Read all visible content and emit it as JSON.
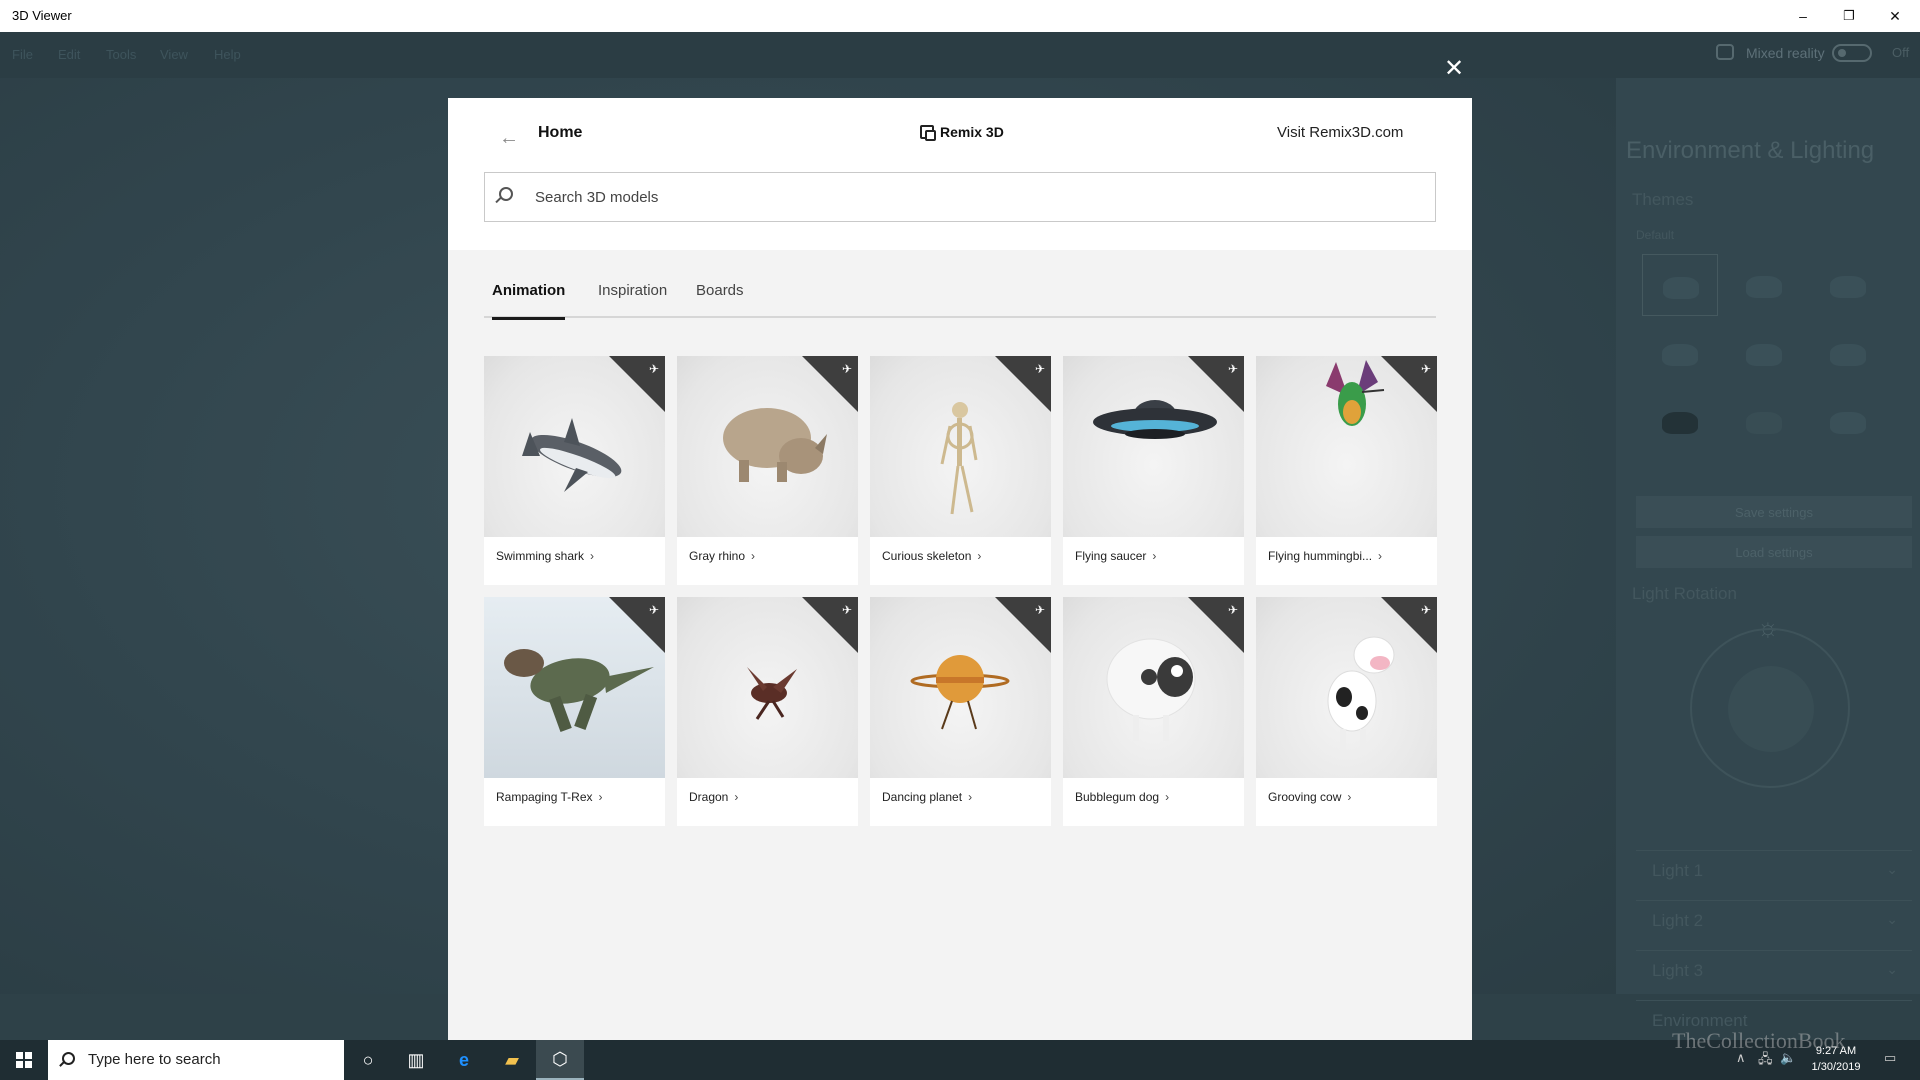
{
  "window": {
    "title": "3D Viewer",
    "minimize": "–",
    "maximize": "❐",
    "close": "✕"
  },
  "background_app": {
    "menu": [
      "File",
      "Edit",
      "Tools",
      "View",
      "Help"
    ],
    "mixed_reality": "Mixed reality",
    "toggle_state": "Off",
    "panel_title": "Environment & Lighting",
    "themes": "Themes",
    "default": "Default",
    "save_settings": "Save settings",
    "load_settings": "Load settings",
    "light_rotation": "Light Rotation",
    "lights": [
      "Light 1",
      "Light 2",
      "Light 3",
      "Environment"
    ]
  },
  "dialog": {
    "close_glyph": "✕",
    "back_glyph": "←",
    "home_title": "Home",
    "brand": "Remix 3D",
    "visit_link": "Visit Remix3D.com",
    "search_placeholder": "Search 3D models",
    "tabs": [
      "Animation",
      "Inspiration",
      "Boards"
    ],
    "active_tab": "Animation",
    "cards": [
      {
        "label": "Swimming shark",
        "thumb": "shark"
      },
      {
        "label": "Gray rhino",
        "thumb": "rhino"
      },
      {
        "label": "Curious skeleton",
        "thumb": "skeleton"
      },
      {
        "label": "Flying saucer",
        "thumb": "saucer"
      },
      {
        "label": "Flying hummingbi...",
        "thumb": "hummingbird"
      },
      {
        "label": "Rampaging T-Rex",
        "thumb": "trex"
      },
      {
        "label": "Dragon",
        "thumb": "dragon"
      },
      {
        "label": "Dancing planet",
        "thumb": "planet"
      },
      {
        "label": "Bubblegum dog",
        "thumb": "dog"
      },
      {
        "label": "Grooving cow",
        "thumb": "cow"
      }
    ],
    "chevron": "›"
  },
  "taskbar": {
    "search_text": "Type here to search",
    "time": "9:27 AM",
    "date": "1/30/2019",
    "watermark": "TheCollectionBook"
  }
}
